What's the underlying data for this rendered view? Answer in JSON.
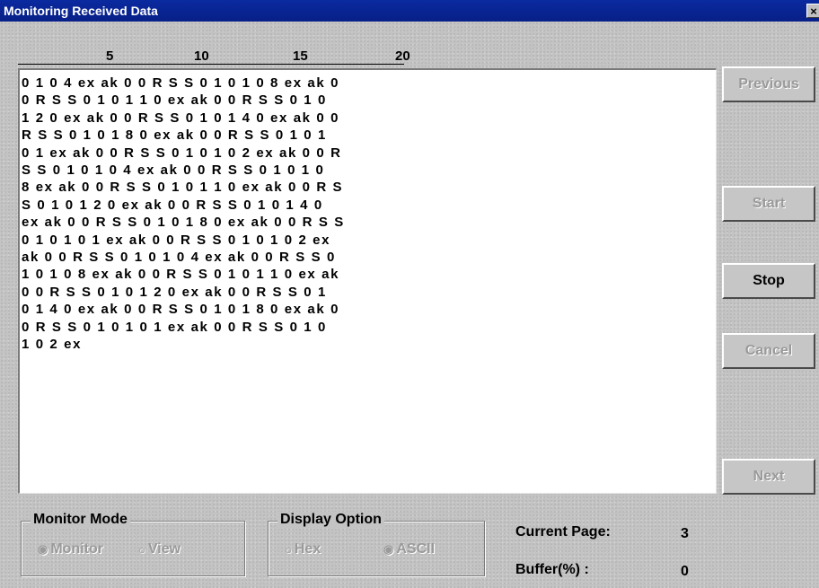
{
  "window": {
    "title": "Monitoring Received Data",
    "close_glyph": "×"
  },
  "ruler": {
    "marks": [
      "5",
      "10",
      "15",
      "20"
    ]
  },
  "data_lines": [
    "0 1 0 4 ex ak 0 0 R S S 0 1 0 1 0 8 ex ak 0",
    "0 R S S 0 1 0 1 1 0 ex ak 0 0 R S S 0 1 0",
    "1 2 0 ex ak 0 0 R S S 0 1 0 1 4 0 ex ak 0 0",
    "R S S 0 1 0 1 8 0 ex ak 0 0 R S S 0 1 0 1",
    "0 1 ex ak 0 0 R S S 0 1 0 1 0 2 ex ak 0 0 R",
    "S S 0 1 0 1 0 4 ex ak 0 0 R S S 0 1 0 1 0",
    "8 ex ak 0 0 R S S 0 1 0 1 1 0 ex ak 0 0 R S",
    "S 0 1 0 1 2 0 ex ak 0 0 R S S 0 1 0 1 4 0",
    "ex ak 0 0 R S S 0 1 0 1 8 0 ex ak 0 0 R S S",
    "0 1 0 1 0 1 ex ak 0 0 R S S 0 1 0 1 0 2 ex",
    "ak 0 0 R S S 0 1 0 1 0 4 ex ak 0 0 R S S 0",
    "1 0 1 0 8 ex ak 0 0 R S S 0 1 0 1 1 0 ex ak",
    "0 0 R S S 0 1 0 1 2 0 ex ak 0 0 R S S 0 1",
    "0 1 4 0 ex ak 0 0 R S S 0 1 0 1 8 0 ex ak 0",
    "0 R S S 0 1 0 1 0 1 ex ak 0 0 R S S 0 1 0",
    "1 0 2 ex"
  ],
  "buttons": {
    "previous": "Previous",
    "start": "Start",
    "stop": "Stop",
    "cancel": "Cancel",
    "next": "Next"
  },
  "monitor_mode": {
    "legend": "Monitor Mode",
    "options": [
      {
        "label": "Monitor",
        "selected": true
      },
      {
        "label": "View",
        "selected": false
      }
    ]
  },
  "display_option": {
    "legend": "Display Option",
    "options": [
      {
        "label": "Hex",
        "selected": false
      },
      {
        "label": "ASCII",
        "selected": true
      }
    ]
  },
  "status": {
    "current_page_label": "Current Page:",
    "current_page_value": "3",
    "buffer_label": "Buffer(%) :",
    "buffer_value": "0"
  },
  "icons": {
    "radio_selected": "◉",
    "radio_unselected": "○"
  }
}
